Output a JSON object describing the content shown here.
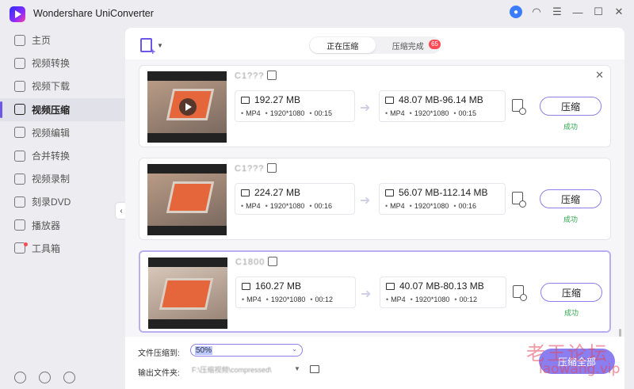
{
  "app": {
    "title": "Wondershare UniConverter"
  },
  "sidebar": {
    "items": [
      {
        "label": "主页",
        "icon": "home-icon"
      },
      {
        "label": "视频转换",
        "icon": "convert-icon"
      },
      {
        "label": "视频下载",
        "icon": "download-icon"
      },
      {
        "label": "视频压缩",
        "icon": "compress-icon",
        "active": true
      },
      {
        "label": "视频编辑",
        "icon": "scissors-icon"
      },
      {
        "label": "合并转换",
        "icon": "merge-icon"
      },
      {
        "label": "视频录制",
        "icon": "record-icon"
      },
      {
        "label": "刻录DVD",
        "icon": "dvd-icon"
      },
      {
        "label": "播放器",
        "icon": "play-icon"
      },
      {
        "label": "工具箱",
        "icon": "toolbox-icon",
        "badge": true
      }
    ]
  },
  "tabs": {
    "compressing": "正在压缩",
    "completed": "压缩完成",
    "completed_count": "65"
  },
  "files": [
    {
      "name": "C1???",
      "source": {
        "size": "192.27 MB",
        "format": "MP4",
        "resolution": "1920*1080",
        "duration": "00:15"
      },
      "target": {
        "size": "48.07 MB-96.14 MB",
        "format": "MP4",
        "resolution": "1920*1080",
        "duration": "00:15"
      },
      "button": "压缩",
      "status": "成功"
    },
    {
      "name": "C1???",
      "source": {
        "size": "224.27 MB",
        "format": "MP4",
        "resolution": "1920*1080",
        "duration": "00:16"
      },
      "target": {
        "size": "56.07 MB-112.14 MB",
        "format": "MP4",
        "resolution": "1920*1080",
        "duration": "00:16"
      },
      "button": "压缩",
      "status": "成功"
    },
    {
      "name": "C1800",
      "source": {
        "size": "160.27 MB",
        "format": "MP4",
        "resolution": "1920*1080",
        "duration": "00:12"
      },
      "target": {
        "size": "40.07 MB-80.13 MB",
        "format": "MP4",
        "resolution": "1920*1080",
        "duration": "00:12"
      },
      "button": "压缩",
      "status": "成功"
    }
  ],
  "footer": {
    "compress_to_label": "文件压缩到:",
    "compress_to_value": "50%",
    "output_label": "输出文件夹:",
    "output_path": "F:\\压缩视频\\compressed\\",
    "compress_all": "压缩全部"
  },
  "watermark": {
    "line1": "老王论坛",
    "line2": "laowang.vip"
  },
  "colors": {
    "accent": "#8a7ef0",
    "success": "#2da84c",
    "badge": "#ff4a55"
  }
}
